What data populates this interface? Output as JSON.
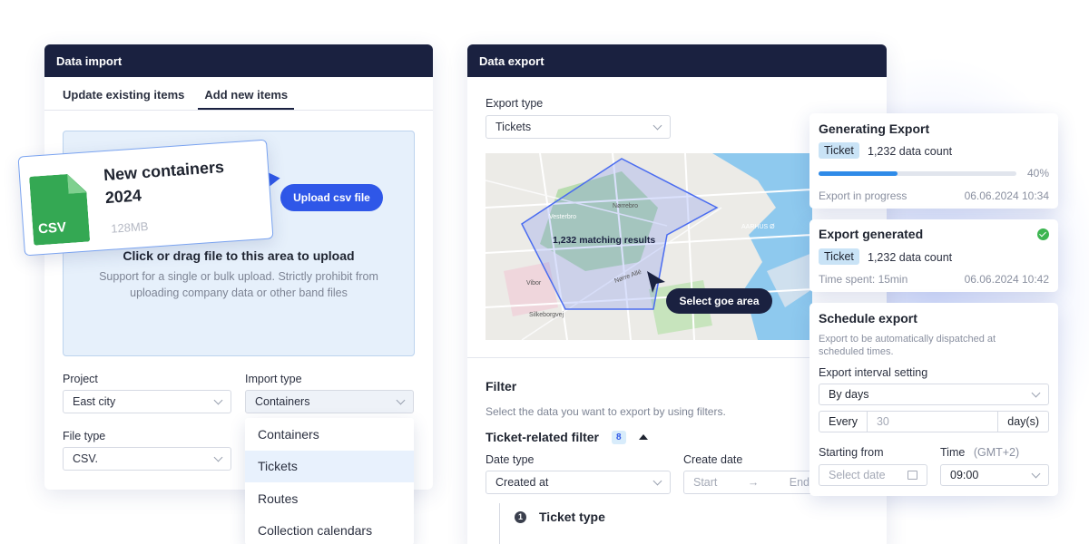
{
  "import_panel": {
    "title": "Data import",
    "tabs": [
      "Update existing items",
      "Add new items"
    ],
    "upload_button": "Upload csv file",
    "dropzone_title": "Click or drag file to this area to upload",
    "dropzone_subtitle": "Support for a single or bulk upload. Strictly prohibit from uploading company data or other band files",
    "file_card": {
      "icon_label": "CSV",
      "name": "New containers 2024",
      "size": "128MB"
    },
    "project_label": "Project",
    "project_value": "East city",
    "import_type_label": "Import type",
    "import_type_value": "Containers",
    "file_type_label": "File type",
    "file_type_value": "CSV.",
    "dropdown_options": [
      "Containers",
      "Tickets",
      "Routes",
      "Collection calendars"
    ],
    "dropdown_selected": "Tickets"
  },
  "export_panel": {
    "title": "Data export",
    "export_type_label": "Export type",
    "export_type_value": "Tickets",
    "map_results": "1,232 matching results",
    "map_labels": [
      "Vesterbro",
      "Nørrebro",
      "Nørre Allé",
      "Vibor",
      "Silkeborgvej",
      "AARHUS Ø"
    ],
    "map_button": "Select goe area",
    "filter_title": "Filter",
    "filter_subtitle": "Select the data you want to export by using filters.",
    "ticket_filter_label": "Ticket-related filter",
    "ticket_filter_count": "8",
    "date_type_label": "Date type",
    "date_type_value": "Created at",
    "create_date_label": "Create date",
    "start_placeholder": "Start",
    "end_placeholder": "End",
    "ticket_type_number": "1",
    "ticket_type_label": "Ticket type"
  },
  "generating_card": {
    "title": "Generating Export",
    "pill": "Ticket",
    "count": "1,232 data count",
    "progress_percent": 40,
    "progress_label": "40%",
    "status": "Export in progress",
    "timestamp": "06.06.2024 10:34"
  },
  "generated_card": {
    "title": "Export generated",
    "pill": "Ticket",
    "count": "1,232 data count",
    "time_spent": "Time spent: 15min",
    "timestamp": "06.06.2024 10:42"
  },
  "schedule_card": {
    "title": "Schedule export",
    "subtitle": "Export to be automatically dispatched at scheduled times.",
    "interval_label": "Export interval setting",
    "interval_value": "By days",
    "every_label": "Every",
    "every_value": "30",
    "unit_label": "day(s)",
    "starting_label": "Starting from",
    "date_placeholder": "Select date",
    "time_label": "Time",
    "timezone": "(GMT+2)",
    "time_value": "09:00"
  },
  "colors": {
    "navy": "#1a2140",
    "accent": "#2f57e8",
    "success": "#3cb550",
    "csv_green": "#34a853"
  }
}
